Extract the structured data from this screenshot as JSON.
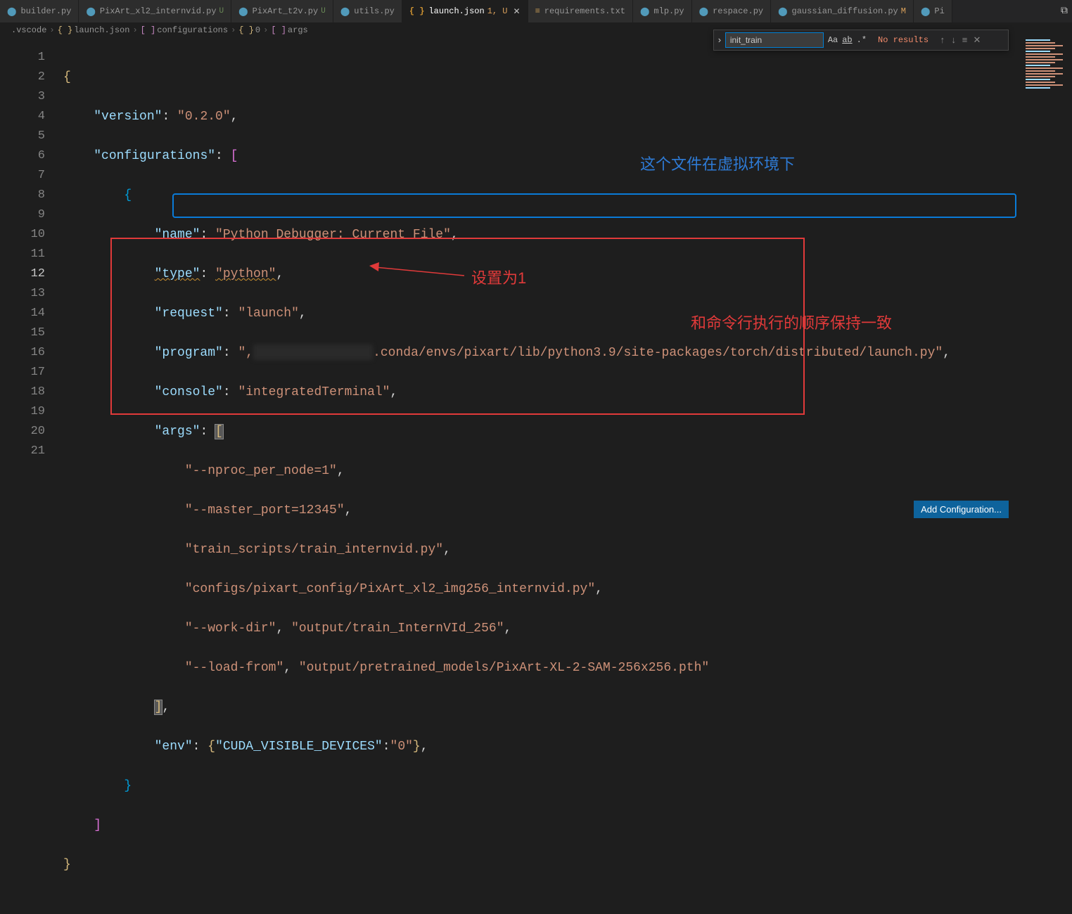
{
  "tabs": [
    {
      "name": "builder.py",
      "icon": "py",
      "mod": ""
    },
    {
      "name": "PixArt_xl2_internvid.py",
      "icon": "py",
      "mod": "U"
    },
    {
      "name": "PixArt_t2v.py",
      "icon": "py",
      "mod": "U"
    },
    {
      "name": "utils.py",
      "icon": "py",
      "mod": ""
    },
    {
      "name": "launch.json",
      "icon": "json",
      "mod": "1, U",
      "active": true,
      "close": true
    },
    {
      "name": "requirements.txt",
      "icon": "txt",
      "mod": ""
    },
    {
      "name": "mlp.py",
      "icon": "py",
      "mod": ""
    },
    {
      "name": "respace.py",
      "icon": "py",
      "mod": ""
    },
    {
      "name": "gaussian_diffusion.py",
      "icon": "py",
      "mod": "M"
    },
    {
      "name": "Pi",
      "icon": "py",
      "mod": ""
    }
  ],
  "breadcrumb": {
    "folder": ".vscode",
    "file": "launch.json",
    "p1": "configurations",
    "p2": "0",
    "p3": "args"
  },
  "find": {
    "value": "init_train",
    "result": "No results",
    "caseLabel": "Aa",
    "wordLabel": "ab",
    "regexLabel": ".*"
  },
  "code": {
    "version_k": "\"version\"",
    "version_v": "\"0.2.0\"",
    "configs_k": "\"configurations\"",
    "name_k": "\"name\"",
    "name_v": "\"Python Debugger: Current File\"",
    "type_k": "\"type\"",
    "type_v": "\"python\"",
    "request_k": "\"request\"",
    "request_v": "\"launch\"",
    "program_k": "\"program\"",
    "program_prefix": "\",",
    "program_suffix": ".conda/envs/pixart/lib/python3.9/site-packages/torch/distributed/launch.py\"",
    "console_k": "\"console\"",
    "console_v": "\"integratedTerminal\"",
    "args_k": "\"args\"",
    "arg0": "\"--nproc_per_node=1\"",
    "arg1": "\"--master_port=12345\"",
    "arg2": "\"train_scripts/train_internvid.py\"",
    "arg3": "\"configs/pixart_config/PixArt_xl2_img256_internvid.py\"",
    "arg4a": "\"--work-dir\"",
    "arg4b": "\"output/train_InternVId_256\"",
    "arg5a": "\"--load-from\"",
    "arg5b": "\"output/pretrained_models/PixArt-XL-2-SAM-256x256.pth\"",
    "env_k": "\"env\"",
    "env_ck": "\"CUDA_VISIBLE_DEVICES\"",
    "env_cv": "\"0\""
  },
  "annotations": {
    "note_env": "这个文件在虚拟环境下",
    "note_set1": "设置为1",
    "note_order": "和命令行执行的顺序保持一致"
  },
  "lineNumbers": [
    "1",
    "2",
    "3",
    "4",
    "5",
    "6",
    "7",
    "8",
    "9",
    "10",
    "11",
    "12",
    "13",
    "14",
    "15",
    "16",
    "17",
    "18",
    "19",
    "20",
    "21"
  ],
  "bottomButton": "Add Configuration..."
}
